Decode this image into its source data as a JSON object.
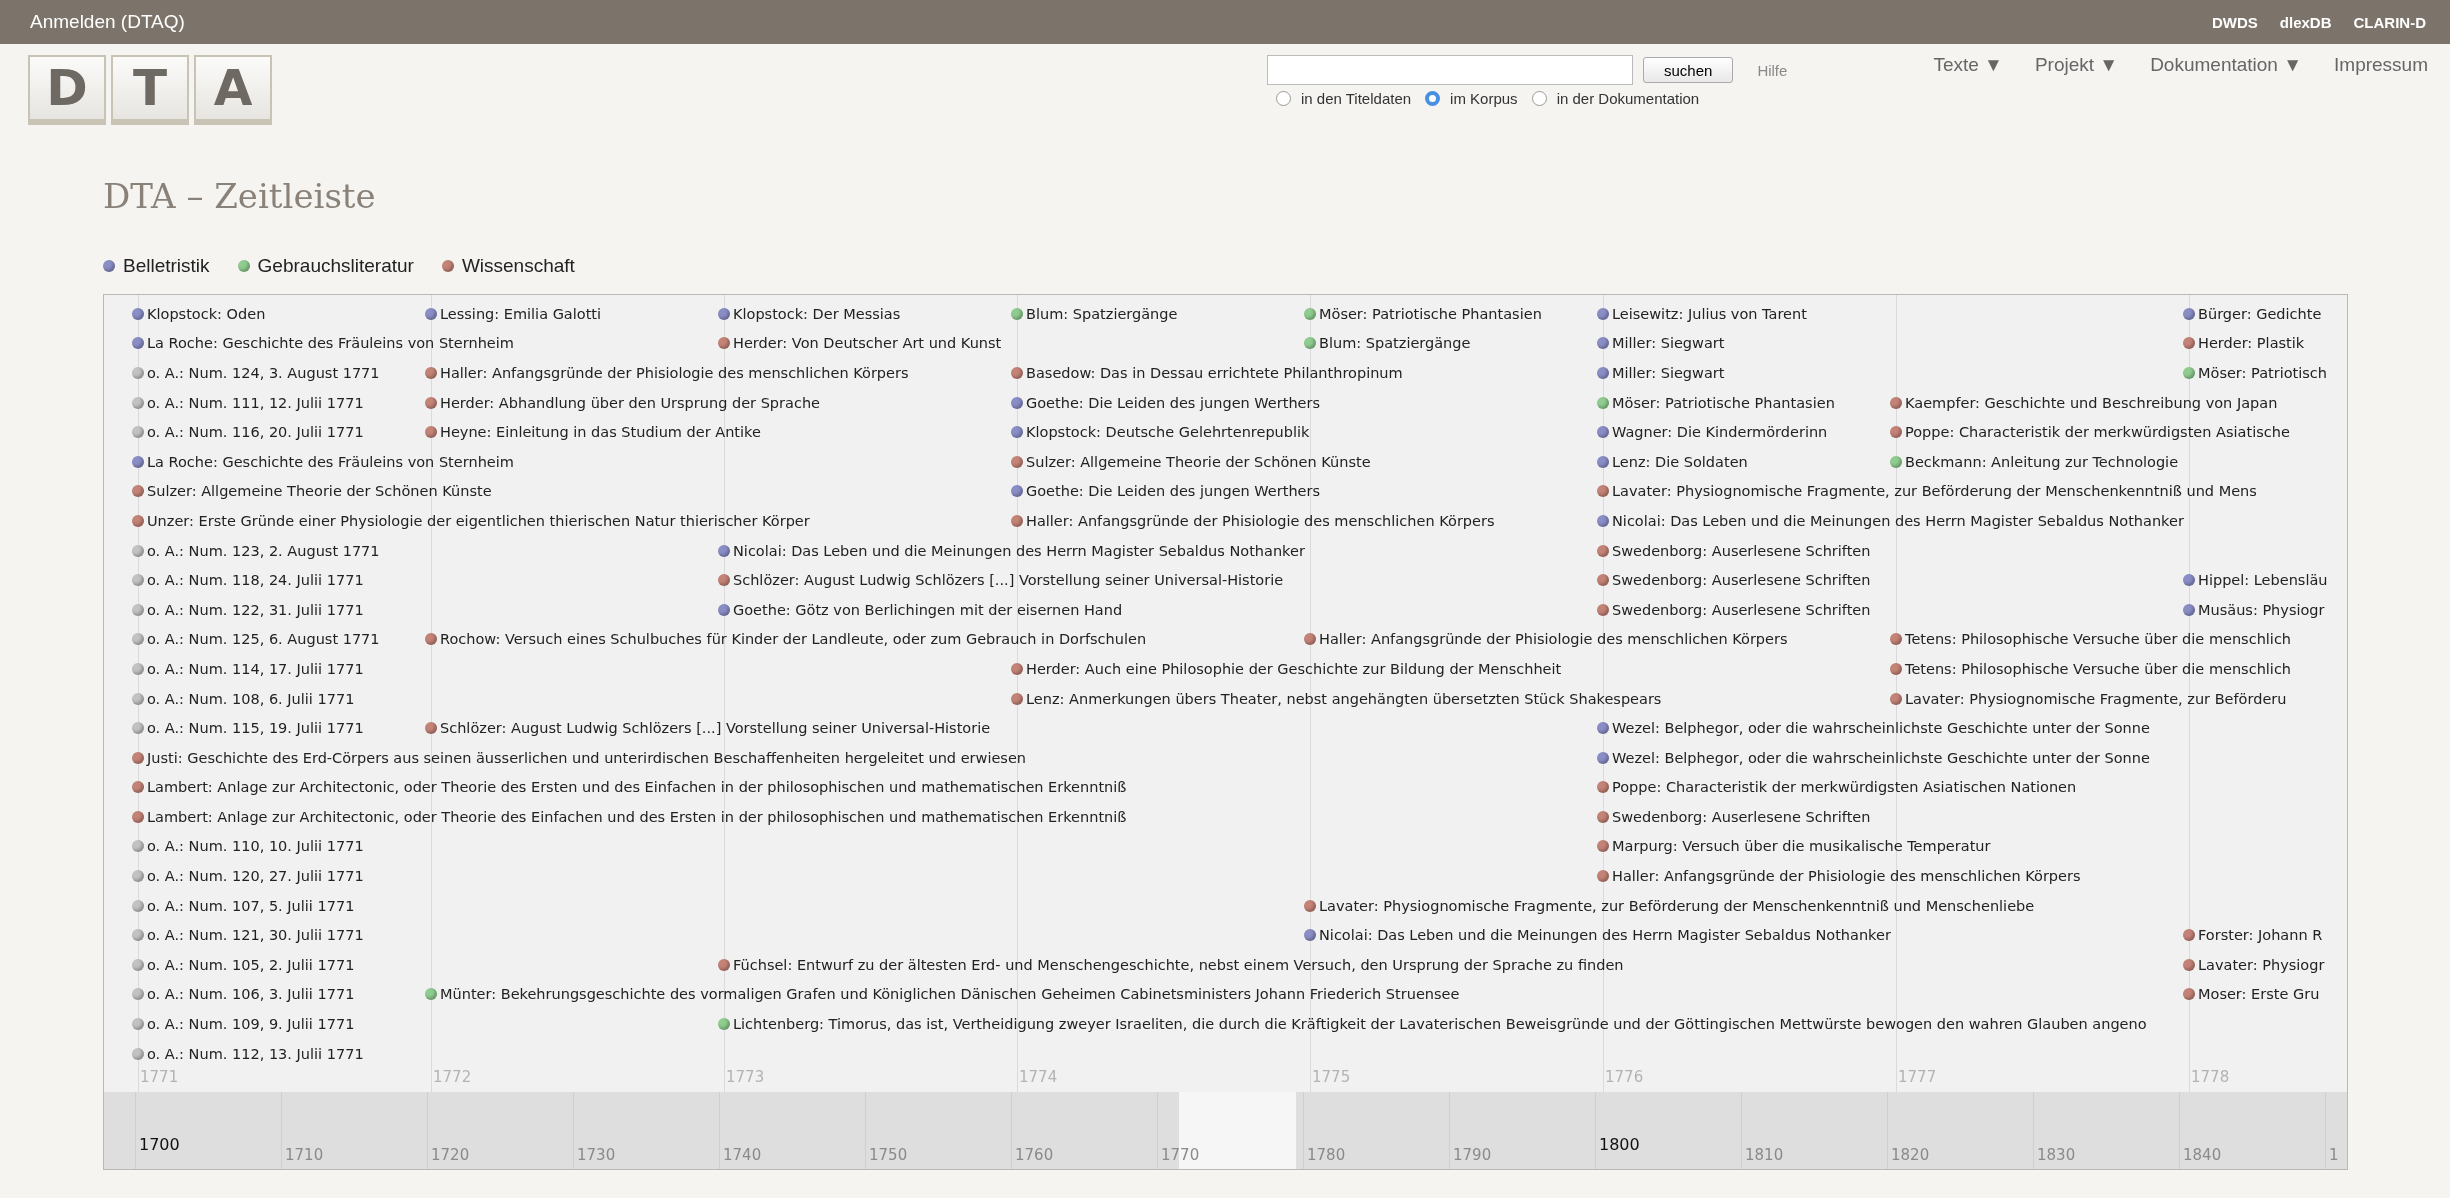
{
  "header": {
    "login": "Anmelden (DTAQ)",
    "links": [
      "DWDS",
      "dlexDB",
      "CLARIN-D"
    ]
  },
  "logo": [
    "D",
    "T",
    "A"
  ],
  "search": {
    "button": "suchen",
    "help": "Hilfe",
    "scopes": [
      {
        "label": "in den Titeldaten",
        "selected": false
      },
      {
        "label": "im Korpus",
        "selected": true
      },
      {
        "label": "in der Dokumentation",
        "selected": false
      }
    ]
  },
  "nav": [
    "Texte ▼",
    "Projekt ▼",
    "Dokumentation ▼",
    "Impressum"
  ],
  "title": "DTA – Zeitleiste",
  "legend": [
    {
      "label": "Belletristik",
      "color": "#8a8ec6"
    },
    {
      "label": "Gebrauchsliteratur",
      "color": "#8fcc8f"
    },
    {
      "label": "Wissenschaft",
      "color": "#c48377"
    }
  ],
  "timeline": {
    "years": [
      "1771",
      "1772",
      "1773",
      "1774",
      "1775",
      "1776",
      "1777",
      "1778"
    ],
    "lanes": [
      {
        "cells": [
          {
            "kind": "event",
            "color": "#8a8ec6",
            "text": "Klopstock: Oden"
          },
          {
            "kind": "event",
            "color": "#8a8ec6",
            "text": "Lessing: Emilia Galotti"
          },
          {
            "kind": "event",
            "color": "#8a8ec6",
            "text": "Klopstock: Der Messias"
          },
          {
            "kind": "event",
            "color": "#8fcc8f",
            "text": "Blum: Spatziergänge"
          },
          {
            "kind": "event",
            "color": "#8fcc8f",
            "text": "Möser: Patriotische Phantasien"
          },
          {
            "kind": "event",
            "color": "#8a8ec6",
            "text": "Leisewitz: Julius von Tarent"
          },
          {
            "kind": "gap"
          },
          {
            "kind": "event",
            "color": "#8a8ec6",
            "text": "Bürger: Gedichte"
          }
        ]
      },
      {
        "cells": [
          {
            "kind": "event",
            "color": "#8a8ec6",
            "text": "La Roche: Geschichte des Fräuleins von Sternheim"
          },
          {
            "kind": "gap"
          },
          {
            "kind": "event",
            "color": "#c48377",
            "text": "Herder: Von Deutscher Art und Kunst"
          },
          {
            "kind": "gap"
          },
          {
            "kind": "event",
            "color": "#8fcc8f",
            "text": "Blum: Spatziergänge"
          },
          {
            "kind": "event",
            "color": "#8a8ec6",
            "text": "Miller: Siegwart"
          },
          {
            "kind": "gap"
          },
          {
            "kind": "event",
            "color": "#c48377",
            "text": "Herder: Plastik"
          }
        ]
      },
      {
        "cells": [
          {
            "kind": "event",
            "color": "#c2c2c2",
            "text": "o. A.: Num. 124, 3. August 1771"
          },
          {
            "kind": "event",
            "color": "#c48377",
            "text": "Haller: Anfangsgründe der Phisiologie des menschlichen Körpers"
          },
          {
            "kind": "gap"
          },
          {
            "kind": "event",
            "color": "#c48377",
            "text": "Basedow: Das in Dessau errichtete Philanthropinum"
          },
          {
            "kind": "gap"
          },
          {
            "kind": "event",
            "color": "#8a8ec6",
            "text": "Miller: Siegwart"
          },
          {
            "kind": "gap"
          },
          {
            "kind": "event",
            "color": "#8fcc8f",
            "text": "Möser: Patriotisch"
          }
        ]
      },
      {
        "cells": [
          {
            "kind": "event",
            "color": "#c2c2c2",
            "text": "o. A.: Num. 111, 12. Julii 1771"
          },
          {
            "kind": "event",
            "color": "#c48377",
            "text": "Herder: Abhandlung über den Ursprung der Sprache"
          },
          {
            "kind": "gap"
          },
          {
            "kind": "event",
            "color": "#8a8ec6",
            "text": "Goethe: Die Leiden des jungen Werthers"
          },
          {
            "kind": "gap"
          },
          {
            "kind": "event",
            "color": "#8fcc8f",
            "text": "Möser: Patriotische Phantasien"
          },
          {
            "kind": "event",
            "color": "#c48377",
            "text": "Kaempfer: Geschichte und Beschreibung von Japan"
          }
        ]
      },
      {
        "cells": [
          {
            "kind": "event",
            "color": "#c2c2c2",
            "text": "o. A.: Num. 116, 20. Julii 1771"
          },
          {
            "kind": "event",
            "color": "#c48377",
            "text": "Heyne: Einleitung in das Studium der Antike"
          },
          {
            "kind": "gap"
          },
          {
            "kind": "event",
            "color": "#8a8ec6",
            "text": "Klopstock: Deutsche Gelehrtenrepublik"
          },
          {
            "kind": "gap"
          },
          {
            "kind": "event",
            "color": "#8a8ec6",
            "text": "Wagner: Die Kindermörderinn"
          },
          {
            "kind": "event",
            "color": "#c48377",
            "text": "Poppe: Characteristik der merkwürdigsten Asiatische"
          }
        ]
      },
      {
        "cells": [
          {
            "kind": "event",
            "color": "#8a8ec6",
            "text": "La Roche: Geschichte des Fräuleins von Sternheim"
          },
          {
            "kind": "gap"
          },
          {
            "kind": "gap"
          },
          {
            "kind": "event",
            "color": "#c48377",
            "text": "Sulzer: Allgemeine Theorie der Schönen Künste"
          },
          {
            "kind": "gap"
          },
          {
            "kind": "event",
            "color": "#8a8ec6",
            "text": "Lenz: Die Soldaten"
          },
          {
            "kind": "event",
            "color": "#8fcc8f",
            "text": "Beckmann: Anleitung zur Technologie"
          }
        ]
      },
      {
        "cells": [
          {
            "kind": "event",
            "color": "#c48377",
            "text": "Sulzer: Allgemeine Theorie der Schönen Künste"
          },
          {
            "kind": "gap"
          },
          {
            "kind": "gap"
          },
          {
            "kind": "event",
            "color": "#8a8ec6",
            "text": "Goethe: Die Leiden des jungen Werthers"
          },
          {
            "kind": "gap"
          },
          {
            "kind": "event",
            "color": "#c48377",
            "text": "Lavater: Physiognomische Fragmente, zur Beförderung der Menschenkenntniß und Mens"
          }
        ]
      },
      {
        "cells": [
          {
            "kind": "event",
            "color": "#c48377",
            "text": "Unzer: Erste Gründe einer Physiologie der eigentlichen thierischen Natur thierischer Körper"
          },
          {
            "kind": "gap"
          },
          {
            "kind": "gap"
          },
          {
            "kind": "event",
            "color": "#c48377",
            "text": "Haller: Anfangsgründe der Phisiologie des menschlichen Körpers"
          },
          {
            "kind": "gap"
          },
          {
            "kind": "event",
            "color": "#8a8ec6",
            "text": "Nicolai: Das Leben und die Meinungen des Herrn Magister Sebaldus Nothanker"
          }
        ]
      },
      {
        "cells": [
          {
            "kind": "event",
            "color": "#c2c2c2",
            "text": "o. A.: Num. 123, 2. August 1771"
          },
          {
            "kind": "gap"
          },
          {
            "kind": "event",
            "color": "#8a8ec6",
            "text": "Nicolai: Das Leben und die Meinungen des Herrn Magister Sebaldus Nothanker"
          },
          {
            "kind": "gap"
          },
          {
            "kind": "gap"
          },
          {
            "kind": "event",
            "color": "#c48377",
            "text": "Swedenborg: Auserlesene Schriften"
          }
        ]
      },
      {
        "cells": [
          {
            "kind": "event",
            "color": "#c2c2c2",
            "text": "o. A.: Num. 118, 24. Julii 1771"
          },
          {
            "kind": "gap"
          },
          {
            "kind": "event",
            "color": "#c48377",
            "text": "Schlözer: August Ludwig Schlözers [...] Vorstellung seiner Universal-Historie"
          },
          {
            "kind": "gap"
          },
          {
            "kind": "gap"
          },
          {
            "kind": "event",
            "color": "#c48377",
            "text": "Swedenborg: Auserlesene Schriften"
          },
          {
            "kind": "gap"
          },
          {
            "kind": "event",
            "color": "#8a8ec6",
            "text": "Hippel: Lebensläu"
          }
        ]
      },
      {
        "cells": [
          {
            "kind": "event",
            "color": "#c2c2c2",
            "text": "o. A.: Num. 122, 31. Julii 1771"
          },
          {
            "kind": "gap"
          },
          {
            "kind": "event",
            "color": "#8a8ec6",
            "text": "Goethe: Götz von Berlichingen mit der eisernen Hand"
          },
          {
            "kind": "gap"
          },
          {
            "kind": "gap"
          },
          {
            "kind": "event",
            "color": "#c48377",
            "text": "Swedenborg: Auserlesene Schriften"
          },
          {
            "kind": "gap"
          },
          {
            "kind": "event",
            "color": "#8a8ec6",
            "text": "Musäus: Physiogr"
          }
        ]
      },
      {
        "cells": [
          {
            "kind": "event",
            "color": "#c2c2c2",
            "text": "o. A.: Num. 125, 6. August 1771"
          },
          {
            "kind": "event",
            "color": "#c48377",
            "text": "Rochow: Versuch eines Schulbuches für Kinder der Landleute, oder zum Gebrauch in Dorfschulen"
          },
          {
            "kind": "gap"
          },
          {
            "kind": "gap"
          },
          {
            "kind": "event",
            "color": "#c48377",
            "text": "Haller: Anfangsgründe der Phisiologie des menschlichen Körpers"
          },
          {
            "kind": "gap"
          },
          {
            "kind": "event",
            "color": "#c48377",
            "text": "Tetens: Philosophische Versuche über die menschlich"
          }
        ]
      },
      {
        "cells": [
          {
            "kind": "event",
            "color": "#c2c2c2",
            "text": "o. A.: Num. 114, 17. Julii 1771"
          },
          {
            "kind": "gap"
          },
          {
            "kind": "gap"
          },
          {
            "kind": "event",
            "color": "#c48377",
            "text": "Herder: Auch eine Philosophie der Geschichte zur Bildung der Menschheit"
          },
          {
            "kind": "gap"
          },
          {
            "kind": "gap"
          },
          {
            "kind": "event",
            "color": "#c48377",
            "text": "Tetens: Philosophische Versuche über die menschlich"
          }
        ]
      },
      {
        "cells": [
          {
            "kind": "event",
            "color": "#c2c2c2",
            "text": "o. A.: Num. 108, 6. Julii 1771"
          },
          {
            "kind": "gap"
          },
          {
            "kind": "gap"
          },
          {
            "kind": "event",
            "color": "#c48377",
            "text": "Lenz: Anmerkungen übers Theater, nebst angehängten übersetzten Stück Shakespears"
          },
          {
            "kind": "gap"
          },
          {
            "kind": "gap"
          },
          {
            "kind": "event",
            "color": "#c48377",
            "text": "Lavater: Physiognomische Fragmente, zur Beförderu"
          }
        ]
      },
      {
        "cells": [
          {
            "kind": "event",
            "color": "#c2c2c2",
            "text": "o. A.: Num. 115, 19. Julii 1771"
          },
          {
            "kind": "event",
            "color": "#c48377",
            "text": "Schlözer: August Ludwig Schlözers [...] Vorstellung seiner Universal-Historie"
          },
          {
            "kind": "gap"
          },
          {
            "kind": "gap"
          },
          {
            "kind": "gap"
          },
          {
            "kind": "event",
            "color": "#8a8ec6",
            "text": "Wezel: Belphegor, oder die wahrscheinlichste Geschichte unter der Sonne"
          }
        ]
      },
      {
        "cells": [
          {
            "kind": "event",
            "color": "#c48377",
            "text": "Justi: Geschichte des Erd-Cörpers aus seinen äusserlichen und unterirdischen Beschaffenheiten hergeleitet und erwiesen"
          },
          {
            "kind": "gap"
          },
          {
            "kind": "gap"
          },
          {
            "kind": "gap"
          },
          {
            "kind": "gap"
          },
          {
            "kind": "event",
            "color": "#8a8ec6",
            "text": "Wezel: Belphegor, oder die wahrscheinlichste Geschichte unter der Sonne"
          }
        ]
      },
      {
        "cells": [
          {
            "kind": "event",
            "color": "#c48377",
            "text": "Lambert: Anlage zur Architectonic, oder Theorie des Ersten und des Einfachen in der philosophischen und mathematischen Erkenntniß"
          },
          {
            "kind": "gap"
          },
          {
            "kind": "gap"
          },
          {
            "kind": "gap"
          },
          {
            "kind": "gap"
          },
          {
            "kind": "event",
            "color": "#c48377",
            "text": "Poppe: Characteristik der merkwürdigsten Asiatischen Nationen"
          }
        ]
      },
      {
        "cells": [
          {
            "kind": "event",
            "color": "#c48377",
            "text": "Lambert: Anlage zur Architectonic, oder Theorie des Einfachen und des Ersten in der philosophischen und mathematischen Erkenntniß"
          },
          {
            "kind": "gap"
          },
          {
            "kind": "gap"
          },
          {
            "kind": "gap"
          },
          {
            "kind": "gap"
          },
          {
            "kind": "event",
            "color": "#c48377",
            "text": "Swedenborg: Auserlesene Schriften"
          }
        ]
      },
      {
        "cells": [
          {
            "kind": "event",
            "color": "#c2c2c2",
            "text": "o. A.: Num. 110, 10. Julii 1771"
          },
          {
            "kind": "gap"
          },
          {
            "kind": "gap"
          },
          {
            "kind": "gap"
          },
          {
            "kind": "gap"
          },
          {
            "kind": "event",
            "color": "#c48377",
            "text": "Marpurg: Versuch über die musikalische Temperatur"
          }
        ]
      },
      {
        "cells": [
          {
            "kind": "event",
            "color": "#c2c2c2",
            "text": "o. A.: Num. 120, 27. Julii 1771"
          },
          {
            "kind": "gap"
          },
          {
            "kind": "gap"
          },
          {
            "kind": "gap"
          },
          {
            "kind": "gap"
          },
          {
            "kind": "event",
            "color": "#c48377",
            "text": "Haller: Anfangsgründe der Phisiologie des menschlichen Körpers"
          }
        ]
      },
      {
        "cells": [
          {
            "kind": "event",
            "color": "#c2c2c2",
            "text": "o. A.: Num. 107, 5. Julii 1771"
          },
          {
            "kind": "gap"
          },
          {
            "kind": "gap"
          },
          {
            "kind": "gap"
          },
          {
            "kind": "event",
            "color": "#c48377",
            "text": "Lavater: Physiognomische Fragmente, zur Beförderung der Menschenkenntniß und Menschenliebe"
          }
        ]
      },
      {
        "cells": [
          {
            "kind": "event",
            "color": "#c2c2c2",
            "text": "o. A.: Num. 121, 30. Julii 1771"
          },
          {
            "kind": "gap"
          },
          {
            "kind": "gap"
          },
          {
            "kind": "gap"
          },
          {
            "kind": "event",
            "color": "#8a8ec6",
            "text": "Nicolai: Das Leben und die Meinungen des Herrn Magister Sebaldus Nothanker"
          },
          {
            "kind": "gap"
          },
          {
            "kind": "gap"
          },
          {
            "kind": "event",
            "color": "#c48377",
            "text": "Forster: Johann R"
          }
        ]
      },
      {
        "cells": [
          {
            "kind": "event",
            "color": "#c2c2c2",
            "text": "o. A.: Num. 105, 2. Julii 1771"
          },
          {
            "kind": "gap"
          },
          {
            "kind": "event",
            "color": "#c48377",
            "text": "Füchsel: Entwurf zu der ältesten Erd- und Menschengeschichte, nebst einem Versuch, den Ursprung der Sprache zu finden"
          },
          {
            "kind": "gap"
          },
          {
            "kind": "gap"
          },
          {
            "kind": "gap"
          },
          {
            "kind": "gap"
          },
          {
            "kind": "event",
            "color": "#c48377",
            "text": "Lavater: Physiogr"
          }
        ]
      },
      {
        "cells": [
          {
            "kind": "event",
            "color": "#c2c2c2",
            "text": "o. A.: Num. 106, 3. Julii 1771"
          },
          {
            "kind": "event",
            "color": "#8fcc8f",
            "text": "Münter: Bekehrungsgeschichte des vormaligen Grafen und Königlichen Dänischen Geheimen Cabinetsministers Johann Friederich Struensee"
          },
          {
            "kind": "gap"
          },
          {
            "kind": "gap"
          },
          {
            "kind": "gap"
          },
          {
            "kind": "gap"
          },
          {
            "kind": "gap"
          },
          {
            "kind": "event",
            "color": "#c48377",
            "text": "Moser: Erste Gru"
          }
        ]
      },
      {
        "cells": [
          {
            "kind": "event",
            "color": "#c2c2c2",
            "text": "o. A.: Num. 109, 9. Julii 1771"
          },
          {
            "kind": "gap"
          },
          {
            "kind": "event",
            "color": "#8fcc8f",
            "text": "Lichtenberg: Timorus, das ist, Vertheidigung zweyer Israeliten, die durch die Kräftigkeit der Lavaterischen Beweisgründe und der Göttingischen Mettwürste bewogen den wahren Glauben angeno"
          }
        ]
      },
      {
        "cells": [
          {
            "kind": "event",
            "color": "#c2c2c2",
            "text": "o. A.: Num. 112, 13. Julii 1771"
          }
        ]
      }
    ],
    "overview": {
      "ticks": [
        {
          "label": "1700",
          "major": true
        },
        {
          "label": "1710",
          "major": false
        },
        {
          "label": "1720",
          "major": false
        },
        {
          "label": "1730",
          "major": false
        },
        {
          "label": "1740",
          "major": false
        },
        {
          "label": "1750",
          "major": false
        },
        {
          "label": "1760",
          "major": false
        },
        {
          "label": "1770",
          "major": false
        },
        {
          "label": "1780",
          "major": false
        },
        {
          "label": "1790",
          "major": false
        },
        {
          "label": "1800",
          "major": true
        },
        {
          "label": "1810",
          "major": false
        },
        {
          "label": "1820",
          "major": false
        },
        {
          "label": "1830",
          "major": false
        },
        {
          "label": "1840",
          "major": false
        },
        {
          "label": "1",
          "major": false
        }
      ]
    }
  }
}
